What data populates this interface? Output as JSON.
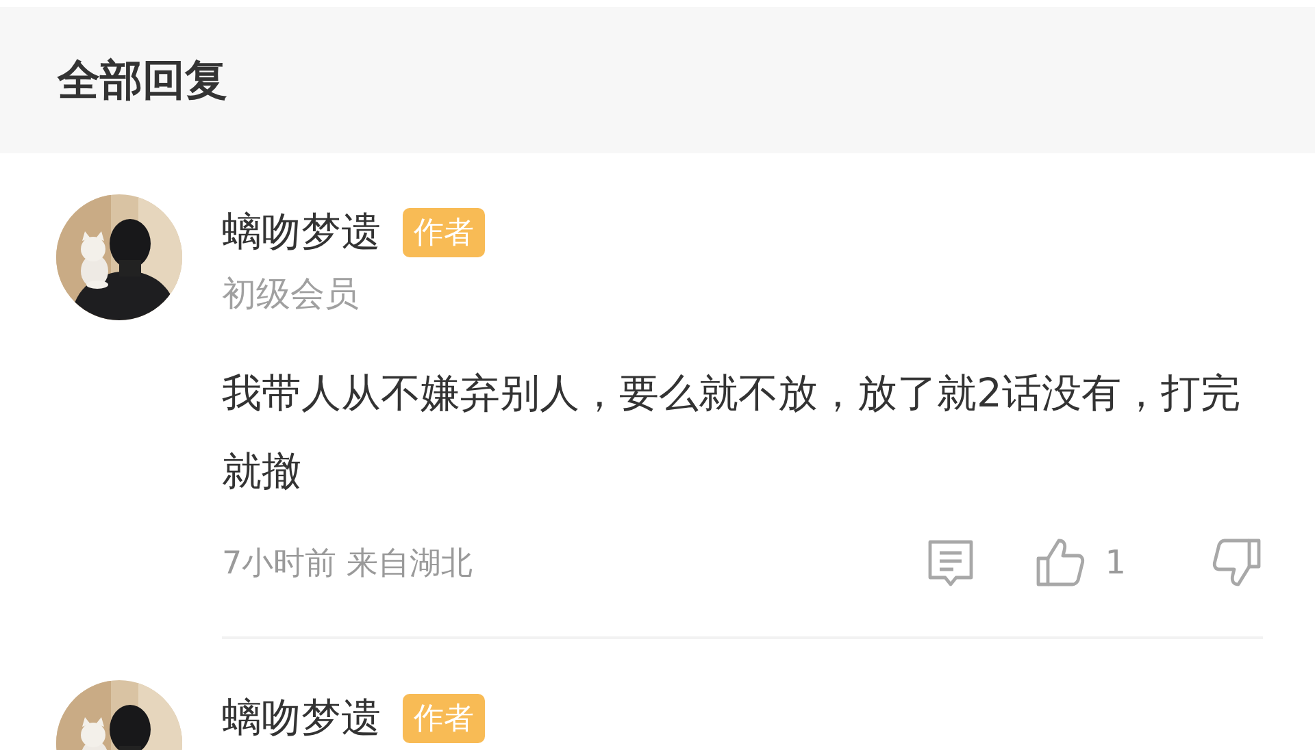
{
  "header": {
    "title": "全部回复"
  },
  "comments": [
    {
      "name": "螭吻梦遗",
      "badge": "作者",
      "level": "初级会员",
      "body": "我带人从不嫌弃别人，要么就不放，放了就2话没有，打完就撤",
      "meta": "7小时前 来自湖北",
      "likes": "1"
    },
    {
      "name": "螭吻梦遗",
      "badge": "作者"
    }
  ]
}
